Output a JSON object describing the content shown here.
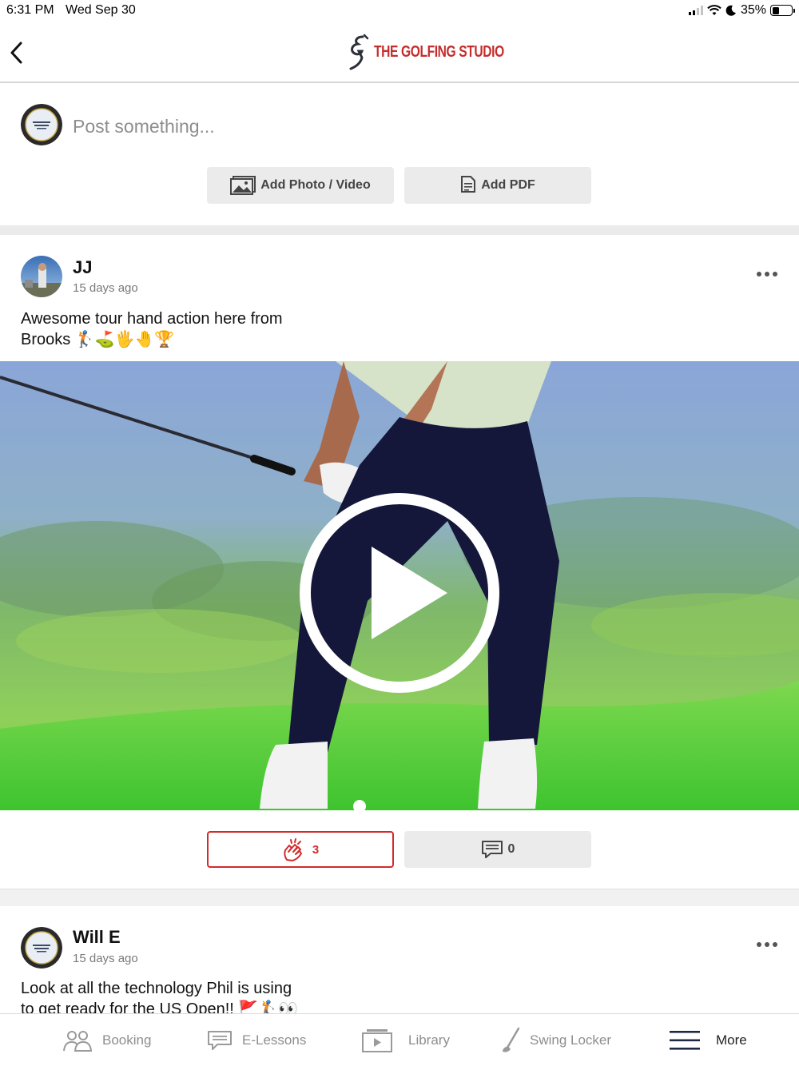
{
  "status_bar": {
    "time": "6:31 PM",
    "date": "Wed Sep 30",
    "battery": "35%",
    "battery_level": 0.35
  },
  "header": {
    "back_icon": "chevron-left-icon",
    "logo_text": "THE GOLFING STUDIO"
  },
  "composer": {
    "placeholder": "Post something...",
    "add_photo_label": "Add Photo / Video",
    "add_pdf_label": "Add PDF"
  },
  "posts": [
    {
      "author": "JJ",
      "time_ago": "15 days ago",
      "text": "Awesome tour hand action here from\nBrooks 🏌️⛳🖐️🤚🏆",
      "media": "video",
      "claps": "3",
      "comments": "0"
    },
    {
      "author": "Will E",
      "time_ago": "15 days ago",
      "text": "Look at all the technology Phil is using\nto get ready for the US Open!! 🚩🏌️👀"
    }
  ],
  "tab_bar": {
    "items": [
      {
        "label": "Booking",
        "icon": "people-icon"
      },
      {
        "label": "E-Lessons",
        "icon": "chat-icon"
      },
      {
        "label": "Library",
        "icon": "video-library-icon"
      },
      {
        "label": "Swing Locker",
        "icon": "golf-club-icon"
      },
      {
        "label": "More",
        "icon": "hamburger-menu-icon"
      }
    ],
    "active_index": 4
  },
  "colors": {
    "brand_red": "#c42d2d",
    "clap_red": "#d32b2b",
    "button_gray": "#ebebeb"
  }
}
